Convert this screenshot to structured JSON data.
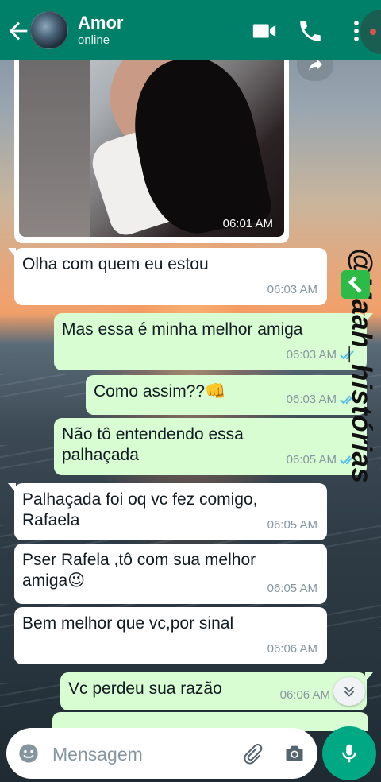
{
  "header": {
    "contact_name": "Amor",
    "status": "online",
    "icons": [
      "back-arrow-icon",
      "video-call-icon",
      "phone-icon",
      "more-menu-icon"
    ],
    "color": "#008069"
  },
  "watermark": {
    "text": "@Maah_histórias"
  },
  "image_message": {
    "time": "06:01 AM"
  },
  "messages": [
    {
      "direction": "in",
      "text": "Olha com quem eu estou",
      "time": "06:03 AM"
    },
    {
      "direction": "out",
      "text": "Mas essa é minha melhor amiga",
      "time": "06:03 AM"
    },
    {
      "direction": "out",
      "text": "Como assim??👊",
      "time": "06:03 AM"
    },
    {
      "direction": "out",
      "text": "Não tô entendendo essa palhaçada",
      "time": "06:05 AM"
    },
    {
      "direction": "in",
      "text": "Palhaçada foi oq vc fez comigo, Rafaela",
      "time": "06:05 AM"
    },
    {
      "direction": "in",
      "text": "Pser Rafela ,tô com sua melhor amiga😉",
      "time": "06:05 AM"
    },
    {
      "direction": "in",
      "text": "Bem melhor que vc,por sinal",
      "time": "06:06 AM"
    },
    {
      "direction": "out",
      "text": "Vc perdeu sua razão",
      "time": "06:06 AM"
    }
  ],
  "input": {
    "placeholder": "Mensagem"
  },
  "colors": {
    "incoming": "#ffffff",
    "outgoing": "#d9fdd3",
    "read_ticks": "#53bdeb",
    "accent": "#00a884"
  }
}
